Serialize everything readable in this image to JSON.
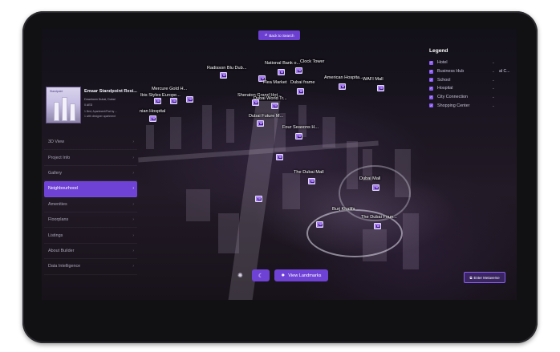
{
  "top": {
    "back_label": "Back to Search",
    "back_icon": "undo-icon"
  },
  "property": {
    "name": "Emaar Standpoint Resi...",
    "location": "Downtown Dubai, Dubai",
    "price": "0 AED",
    "features": [
      "1 Bed, Apartment/Flat by ...",
      "1 with designer apartment"
    ],
    "thumb_tag": "Standpoint"
  },
  "menu": {
    "items": [
      {
        "label": "3D View",
        "active": false
      },
      {
        "label": "Project Info",
        "active": false
      },
      {
        "label": "Gallery",
        "active": false
      },
      {
        "label": "Neighbourhood",
        "active": true
      },
      {
        "label": "Amenities",
        "active": false
      },
      {
        "label": "Floorplans",
        "active": false
      },
      {
        "label": "Listings",
        "active": false
      },
      {
        "label": "About Builder",
        "active": false
      },
      {
        "label": "Data Intelligence",
        "active": false
      }
    ],
    "chevron": "›"
  },
  "legend": {
    "title": "Legend",
    "items": [
      "Hotel",
      "Business Hub",
      "School",
      "Hospital",
      "City Connection",
      "Shopping Center"
    ],
    "extra_label": "al C..."
  },
  "landmarks": [
    {
      "name": "Radisson Blu Dub..."
    },
    {
      "name": "National Bank o..."
    },
    {
      "name": "Clock Tower"
    },
    {
      "name": "Flea Market"
    },
    {
      "name": "Dubai frame"
    },
    {
      "name": "American Hospita..."
    },
    {
      "name": "WAFI Mall"
    },
    {
      "name": "Mercure Gold H..."
    },
    {
      "name": "Ibis Styles Europe..."
    },
    {
      "name": "Sheraton Grand Hot..."
    },
    {
      "name": "Dubai World Tr..."
    },
    {
      "name": "nian Hospital"
    },
    {
      "name": "Dubai Future M..."
    },
    {
      "name": "Four Seasons H..."
    },
    {
      "name": "The Dubai Mall"
    },
    {
      "name": "Dubai Mall"
    },
    {
      "name": "Burj Khalifa"
    },
    {
      "name": "The Dubai Foun..."
    }
  ],
  "bottom": {
    "theme_icon": "moon-icon",
    "sun_icon": "sun-icon",
    "landmarks_label": "View Landmarks",
    "landmarks_icon": "star-icon",
    "metaverse_label": "Enter Metaverse",
    "metaverse_icon": "external-icon"
  },
  "colors": {
    "accent": "#6f42d6",
    "marker": "#a77cf2",
    "background": "#0d0b10"
  }
}
